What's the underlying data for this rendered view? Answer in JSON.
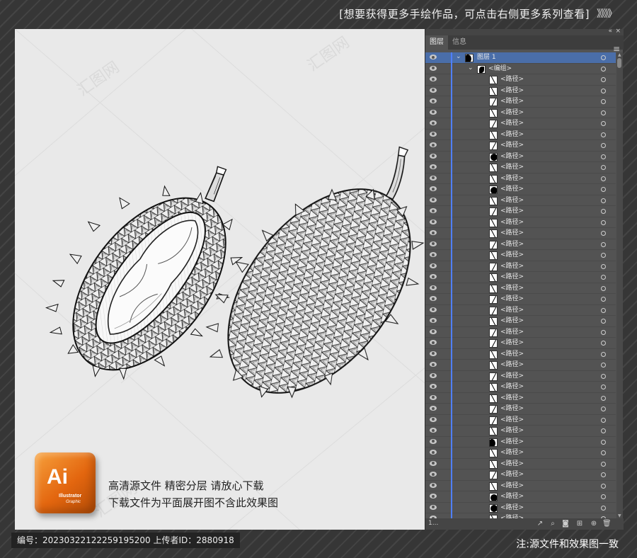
{
  "banner": {
    "text": "[想要获得更多手绘作品，可点击右侧更多系列查看]",
    "arrows": "》》》》"
  },
  "promo": {
    "logo_text": "Ai",
    "logo_sub1": "Illustrator",
    "logo_sub2": "Graphic",
    "line1": "高清源文件   精密分层   请放心下载",
    "line2": "下载文件为平面展开图不含此效果图"
  },
  "panel": {
    "tabs": [
      "图层",
      "信息"
    ],
    "menu_icon": "≡",
    "collapse_icon": "«",
    "close_icon": "×",
    "layer_name": "图层 1",
    "group_name": "<编组>",
    "path_label": "<路径>",
    "layer_count": "1...",
    "path_thumbs": [
      "slash",
      "slash",
      "back",
      "slash",
      "back",
      "slash",
      "back",
      "dot",
      "slash",
      "slash",
      "dot",
      "slash",
      "back",
      "slash",
      "slash",
      "back",
      "slash",
      "back",
      "slash",
      "slash",
      "back",
      "back",
      "slash",
      "back",
      "back",
      "slash",
      "slash",
      "back",
      "slash",
      "slash",
      "back",
      "back",
      "slash",
      "big",
      "slash",
      "slash",
      "back",
      "slash",
      "dot",
      "dot",
      "slash",
      "slash",
      "dot"
    ],
    "bottom_icons": [
      "export-icon",
      "locate-icon",
      "mask-icon",
      "new-sublayer-icon",
      "new-layer-icon",
      "trash-icon"
    ]
  },
  "footer": {
    "id_text": "编号：20230322122259195200  上传者ID：2880918",
    "note": "注:源文件和效果图一致"
  },
  "colors": {
    "background": "#3a3a3a",
    "canvas": "#e9e9e9",
    "panel": "#535353",
    "selected_row": "#4a6ea9",
    "accent_orange": "#e3660f"
  }
}
